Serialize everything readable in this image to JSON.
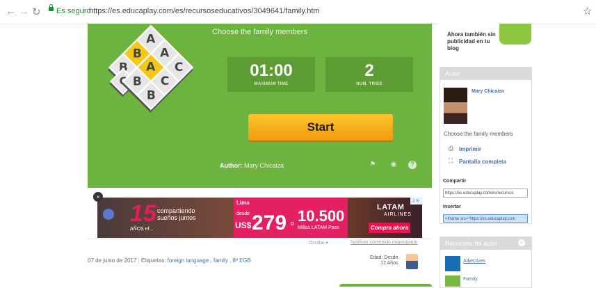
{
  "browser": {
    "back_icon": "arrow-left-icon",
    "forward_icon": "arrow-right-icon",
    "reload_icon": "reload-icon",
    "secure_label": "Es seguro",
    "url": "https://es.educaplay.com/es/recursoseducativos/3049641/family.htm",
    "star_icon": "star-icon"
  },
  "game": {
    "title": "Choose the family members",
    "logo_letters": [
      "A",
      "B",
      "A",
      "B",
      "C",
      "A",
      "C",
      "B",
      "C",
      "B"
    ],
    "time_value": "01:00",
    "time_label": "MAXIMUM TIME",
    "try_value": "2",
    "try_label": "NUM. TRIES",
    "start_label": "Start",
    "author_prefix": "Author:",
    "author_name": "Mary Chicaiza",
    "icons": [
      "flag-icon",
      "share-icon",
      "help-icon"
    ]
  },
  "ad": {
    "close": "×",
    "num": "15",
    "anos": "AÑOS ef...",
    "text1": "compartiendo sueños juntos",
    "lima": "Lima",
    "desde": "desde",
    "currency": "US$",
    "price": "279",
    "o": "o",
    "miles": "10.500",
    "millas": "Millas LATAM Pass",
    "brand": "LATAM",
    "airlines": "AIRLINES",
    "cta": "Compra ahora",
    "info": "i ×",
    "footer_a": "Ocultar ▾",
    "footer_b": "Notificar contenido inapropiado"
  },
  "meta": {
    "date": "07 de junio de 2017",
    "tags_label": "Etiquetas:",
    "tags": "foreign language , family , 8º EGB",
    "made_line1": "Edad: Desde",
    "made_line2": "12 Años"
  },
  "sidebar": {
    "promo": "Ahora también sin publicidad en tu blog",
    "autor_title": "Autor",
    "author_name": "Mary Chicaiza",
    "description": "Choose the family members",
    "imprimir": "Imprimir",
    "pantalla": "Pantalla completa",
    "compartir_label": "Compartir",
    "compartir_value": "https://es.educaplay.com/es/recursos",
    "insertar_label": "Insertar",
    "insertar_value": "<iframe src=\"https://es.educaplay.com",
    "recursos_title": "Recursos del autor",
    "rec1": "Adjectives",
    "rec2": "Family"
  },
  "colors": {
    "game_green": "#6db33f",
    "stat_green": "#5c9c33",
    "start_orange": "#f7a51c",
    "ad_pink": "#e51f63",
    "link_blue": "#4a6fa5"
  }
}
